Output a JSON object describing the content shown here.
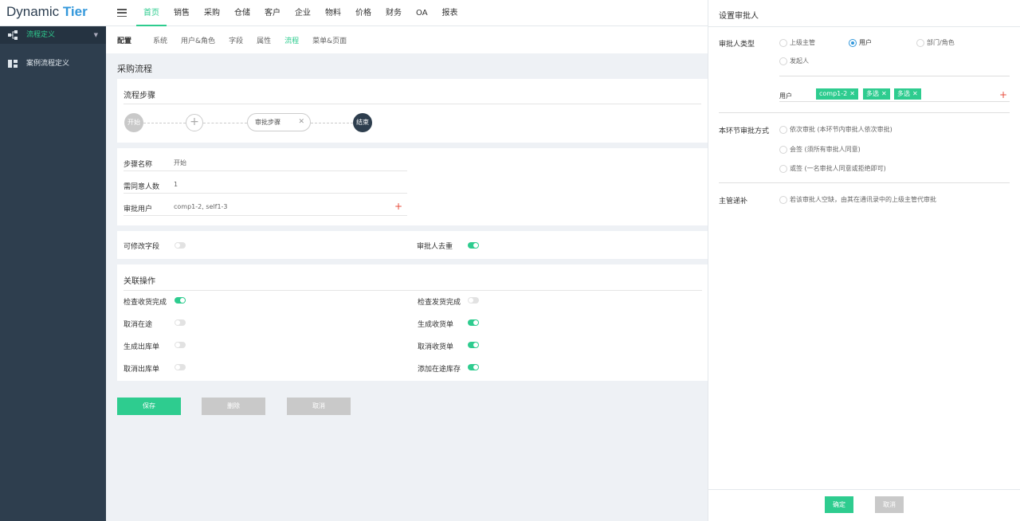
{
  "app": {
    "name_part1": "Dynamic",
    "name_part2": "Tier"
  },
  "topnav": {
    "items": [
      "首页",
      "销售",
      "采购",
      "仓储",
      "客户",
      "企业",
      "物料",
      "价格",
      "财务",
      "OA",
      "报表"
    ],
    "active_index": 0
  },
  "sidebar": {
    "items": [
      {
        "label": "流程定义",
        "icon": "flow-icon",
        "active": true
      },
      {
        "label": "案例流程定义",
        "icon": "case-flow-icon",
        "active": false
      }
    ]
  },
  "subnav": {
    "label": "配置",
    "items": [
      "系统",
      "用户&角色",
      "字段",
      "属性",
      "流程",
      "菜单&页面"
    ],
    "active_index": 4
  },
  "page": {
    "title": "采购流程"
  },
  "flow": {
    "title": "流程步骤",
    "start": "开始",
    "add": "+",
    "step": "审批步骤",
    "step_close": "✕",
    "end": "结束"
  },
  "step_info": {
    "rows": [
      {
        "key": "步骤名称",
        "value": "开始"
      },
      {
        "key": "需同意人数",
        "value": "1"
      },
      {
        "key": "审批用户",
        "value": "comp1-2, self1-3",
        "add": "+"
      }
    ]
  },
  "settings": {
    "editable_fields": {
      "label": "可修改字段",
      "on": false
    },
    "dedupe_approvers": {
      "label": "审批人去重",
      "on": true
    }
  },
  "operations": {
    "title": "关联操作",
    "left": [
      {
        "label": "检查收货完成",
        "on": true
      },
      {
        "label": "取消在途",
        "on": false
      },
      {
        "label": "生成出库单",
        "on": false
      },
      {
        "label": "取消出库单",
        "on": false
      }
    ],
    "right": [
      {
        "label": "检查发货完成",
        "on": false
      },
      {
        "label": "生成收货单",
        "on": true
      },
      {
        "label": "取消收货单",
        "on": true
      },
      {
        "label": "添加在途库存",
        "on": true
      }
    ]
  },
  "buttons": {
    "save": "保存",
    "delete": "删除",
    "cancel": "取消"
  },
  "panel": {
    "title": "设置审批人",
    "approver_type": {
      "label": "审批人类型",
      "options": [
        "上级主管",
        "用户",
        "部门/角色",
        "发起人"
      ],
      "selected": "用户"
    },
    "users": {
      "label": "用户",
      "tags": [
        "comp1-2",
        "多选",
        "多选"
      ],
      "tag_close": "✕",
      "add": "+"
    },
    "method": {
      "label": "本环节审批方式",
      "options": [
        "依次审批 (本环节内审批人依次审批)",
        "会签 (须所有审批人同意)",
        "或签 (一名审批人同意或拒绝即可)"
      ]
    },
    "fallback": {
      "label": "主管递补",
      "option": "若该审批人空缺，由其在通讯录中的上级主管代审批"
    },
    "confirm": "确定",
    "cancel": "取消"
  },
  "colors": {
    "accent": "#2ecc8f",
    "sidebar": "#2e3e4e",
    "brand_blue": "#3498db",
    "danger": "#e74c3c"
  }
}
